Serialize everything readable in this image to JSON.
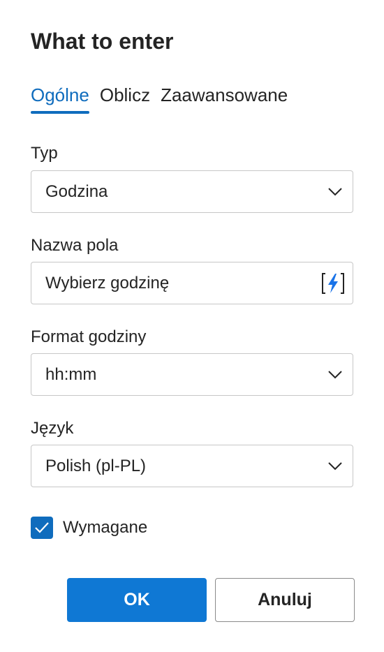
{
  "dialog": {
    "title": "What to enter",
    "tabs": [
      {
        "label": "Ogólne",
        "active": true
      },
      {
        "label": "Oblicz",
        "active": false
      },
      {
        "label": "Zaawansowane",
        "active": false
      }
    ],
    "fields": {
      "type": {
        "label": "Typ",
        "value": "Godzina",
        "icon": "chevron-down-icon"
      },
      "field_name": {
        "label": "Nazwa pola",
        "value": "Wybierz godzinę",
        "icon": "dynamic-content-lightning-icon"
      },
      "time_format": {
        "label": "Format godziny",
        "value": "hh:mm",
        "icon": "chevron-down-icon"
      },
      "language": {
        "label": "Język",
        "value": "Polish (pl-PL)",
        "icon": "chevron-down-icon"
      }
    },
    "required": {
      "label": "Wymagane",
      "checked": true,
      "icon": "checkmark-icon"
    },
    "buttons": {
      "ok": "OK",
      "cancel": "Anuluj"
    }
  },
  "colors": {
    "accent": "#0f6cbd",
    "primary_button": "#0f78d4",
    "lightning": "#1a73e8",
    "border": "#c7c7c7"
  }
}
